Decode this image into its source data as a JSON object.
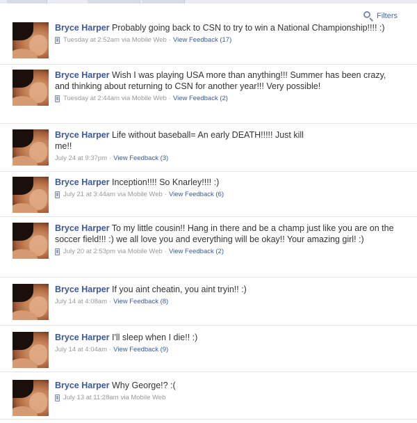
{
  "header": {
    "filters_label": "Filters"
  },
  "stories": [
    {
      "name": "Bryce Harper",
      "text": "Probably going back to CSN to try to win a National Championship!!!! :)",
      "time": "Tuesday at 2:52am",
      "via": "via Mobile Web",
      "feedback": "View Feedback (17)"
    },
    {
      "name": "Bryce Harper",
      "text": "Wish I was playing USA more than anything!!! Summer has been crazy, and thinking about returning to CSN for another year!!! Very possible!",
      "time": "Tuesday at 2:44am",
      "via": "via Mobile Web",
      "feedback": "View Feedback (2)"
    },
    {
      "name": "Bryce Harper",
      "text": "Life without baseball= An early DEATH!!!!! Just kill me!!",
      "time": "July 24 at 9:37pm",
      "via": "",
      "feedback": "View Feedback (3)"
    },
    {
      "name": "Bryce Harper",
      "text": "Inception!!!! So Knarley!!!! :)",
      "time": "July 21 at 3:44am",
      "via": "via Mobile Web",
      "feedback": "View Feedback (6)"
    },
    {
      "name": "Bryce Harper",
      "text": "To my little cousin!! Hang in there and be a champ just like you are on the soccer field!!! :) we all love you and everything will be okay!! Your amazing girl! :)",
      "time": "July 20 at 2:53pm",
      "via": "via Mobile Web",
      "feedback": "View Feedback (2)"
    },
    {
      "name": "Bryce Harper",
      "text": "If you aint cheatin, you aint tryin!! :)",
      "time": "July 14 at 4:08am",
      "via": "",
      "feedback": "View Feedback (8)"
    },
    {
      "name": "Bryce Harper",
      "text": "I'll sleep when I die!! :)",
      "time": "July 14 at 4:04am",
      "via": "",
      "feedback": "View Feedback (9)"
    },
    {
      "name": "Bryce Harper",
      "text": "Why George!? :(",
      "time": "July 13 at 11:28am",
      "via": "via Mobile Web",
      "feedback": ""
    }
  ],
  "colors": {
    "link": "#3b5998",
    "meta": "#999999",
    "separator": "#e5e5e5"
  }
}
